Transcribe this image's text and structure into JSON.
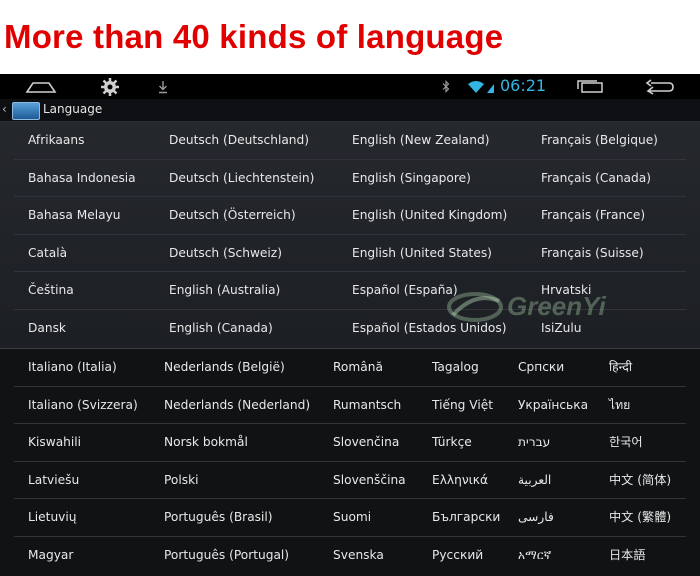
{
  "banner": {
    "text": "More than 40 kinds of language",
    "color": "#e00000"
  },
  "statusbar": {
    "time": "06:21",
    "icons": [
      "home-icon",
      "settings-gear-icon",
      "download-icon",
      "bluetooth-icon",
      "wifi-icon",
      "recent-apps-icon",
      "back-icon"
    ]
  },
  "actionbar": {
    "title": "Language"
  },
  "section1": {
    "rows": [
      [
        "Afrikaans",
        "Deutsch (Deutschland)",
        "English (New Zealand)",
        "Français (Belgique)"
      ],
      [
        "Bahasa Indonesia",
        "Deutsch (Liechtenstein)",
        "English (Singapore)",
        "Français (Canada)"
      ],
      [
        "Bahasa Melayu",
        "Deutsch (Österreich)",
        "English (United Kingdom)",
        "Français (France)"
      ],
      [
        "Català",
        "Deutsch (Schweiz)",
        "English (United States)",
        "Français (Suisse)"
      ],
      [
        "Čeština",
        "English (Australia)",
        "Español (España)",
        "Hrvatski"
      ],
      [
        "Dansk",
        "English (Canada)",
        "Español (Estados Unidos)",
        "IsiZulu"
      ]
    ]
  },
  "section2": {
    "rows": [
      [
        "Italiano (Italia)",
        "Nederlands (België)",
        "Română",
        "Tagalog",
        "Српски",
        "हिन्दी"
      ],
      [
        "Italiano (Svizzera)",
        "Nederlands (Nederland)",
        "Rumantsch",
        "Tiếng Việt",
        "Українська",
        "ไทย"
      ],
      [
        "Kiswahili",
        "Norsk bokmål",
        "Slovenčina",
        "Türkçe",
        "עברית",
        "한국어"
      ],
      [
        "Latviešu",
        "Polski",
        "Slovenščina",
        "Ελληνικά",
        "العربية",
        "中文 (简体)"
      ],
      [
        "Lietuvių",
        "Português (Brasil)",
        "Suomi",
        "Български",
        "فارسی",
        "中文 (繁體)"
      ],
      [
        "Magyar",
        "Português (Portugal)",
        "Svenska",
        "Русский",
        "አማርኛ",
        "日本語"
      ]
    ]
  },
  "watermark": {
    "text": "GreenYi"
  }
}
